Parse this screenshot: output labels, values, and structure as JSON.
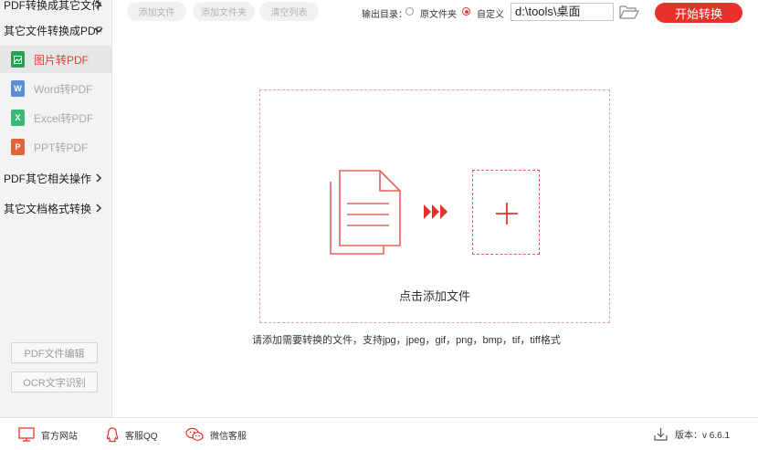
{
  "sidebar": {
    "top_cut": "PDF转换成其它文件",
    "categories": [
      {
        "label": "其它文件转换成PDF"
      },
      {
        "label": "PDF其它相关操作"
      },
      {
        "label": "其它文档格式转换"
      }
    ],
    "items": [
      {
        "label": "图片转PDF",
        "icon": "image-file-icon",
        "color": "#2e9d4f"
      },
      {
        "label": "Word转PDF",
        "icon": "word-file-icon",
        "color": "#5b8fd4"
      },
      {
        "label": "Excel转PDF",
        "icon": "excel-file-icon",
        "color": "#3fb877"
      },
      {
        "label": "PPT转PDF",
        "icon": "ppt-file-icon",
        "color": "#e0643a"
      }
    ],
    "icon_letters": [
      "W",
      "X",
      "P"
    ],
    "buttons": {
      "edit": "PDF文件编辑",
      "ocr": "OCR文字识别"
    }
  },
  "toolbar": {
    "add_file": "添加文件",
    "add_folder": "添加文件夹",
    "clear_list": "清空列表",
    "output_label": "输出目录：",
    "option_original": "原文件夹",
    "option_custom": "自定义",
    "path": "d:\\tools\\桌面",
    "start": "开始转换",
    "accent_color": "#e8312b"
  },
  "main": {
    "drop_text": "点击添加文件",
    "hint": "请添加需要转换的文件，支持jpg，jpeg，gif，png，bmp，tif，tiff格式"
  },
  "footer": {
    "website": "官方网站",
    "qq": "客服QQ",
    "wechat": "微信客服",
    "version": "版本：v 6.6.1"
  }
}
